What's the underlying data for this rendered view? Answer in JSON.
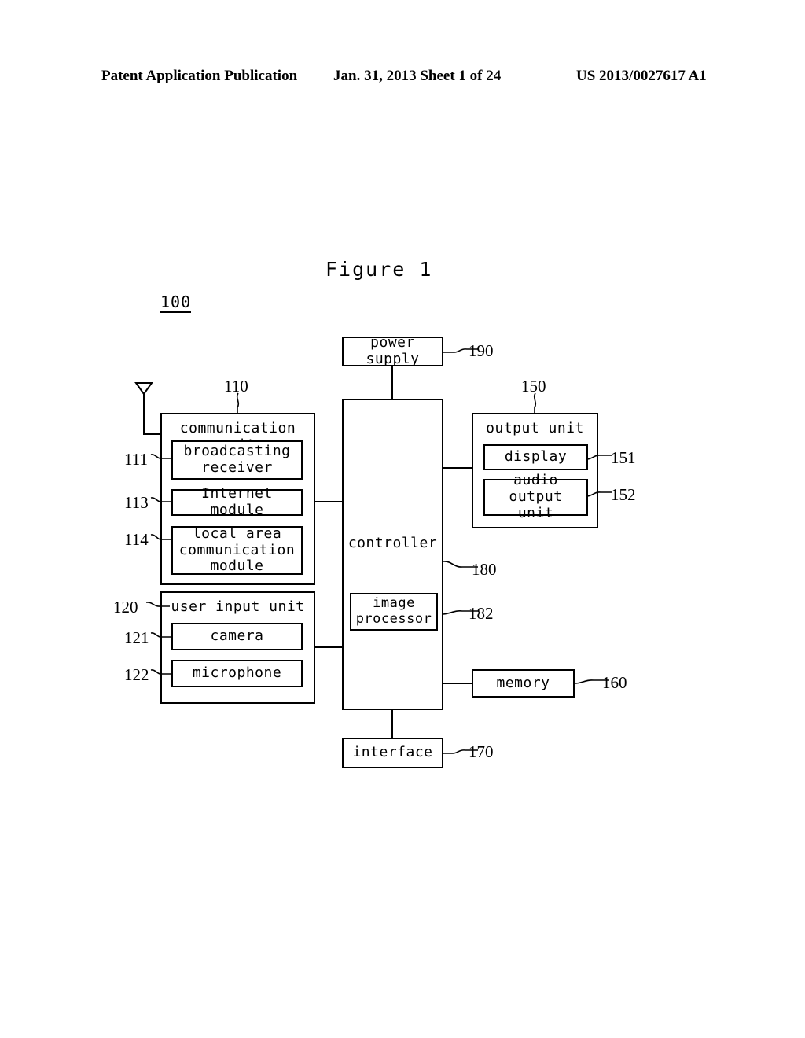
{
  "header": {
    "publication": "Patent Application Publication",
    "date_sheet": "Jan. 31, 2013  Sheet 1 of 24",
    "pub_number": "US 2013/0027617 A1"
  },
  "figure": {
    "title": "Figure 1",
    "system_ref": "100"
  },
  "blocks": {
    "power_supply": {
      "label": "power supply",
      "ref": "190"
    },
    "communication_unit": {
      "label": "communication unit",
      "ref": "110"
    },
    "broadcasting_receiver": {
      "label": "broadcasting\nreceiver",
      "line1": "broadcasting",
      "line2": "receiver",
      "ref": "111"
    },
    "internet_module": {
      "label": "Internet module",
      "ref": "113"
    },
    "local_area_module": {
      "line1": "local area",
      "line2": "communication",
      "line3": "module",
      "ref": "114"
    },
    "user_input_unit": {
      "label": "user input unit",
      "ref": "120"
    },
    "camera": {
      "label": "camera",
      "ref": "121"
    },
    "microphone": {
      "label": "microphone",
      "ref": "122"
    },
    "controller": {
      "label": "controller",
      "ref": "180"
    },
    "image_processor": {
      "line1": "image",
      "line2": "processor",
      "ref": "182"
    },
    "output_unit": {
      "label": "output unit",
      "ref": "150"
    },
    "display": {
      "label": "display",
      "ref": "151"
    },
    "audio_output_unit": {
      "line1": "audio output",
      "line2": "unit",
      "ref": "152"
    },
    "memory": {
      "label": "memory",
      "ref": "160"
    },
    "interface": {
      "label": "interface",
      "ref": "170"
    }
  },
  "icons": {
    "antenna": "antenna-icon"
  },
  "colors": {
    "ink": "#000000",
    "paper": "#ffffff"
  }
}
